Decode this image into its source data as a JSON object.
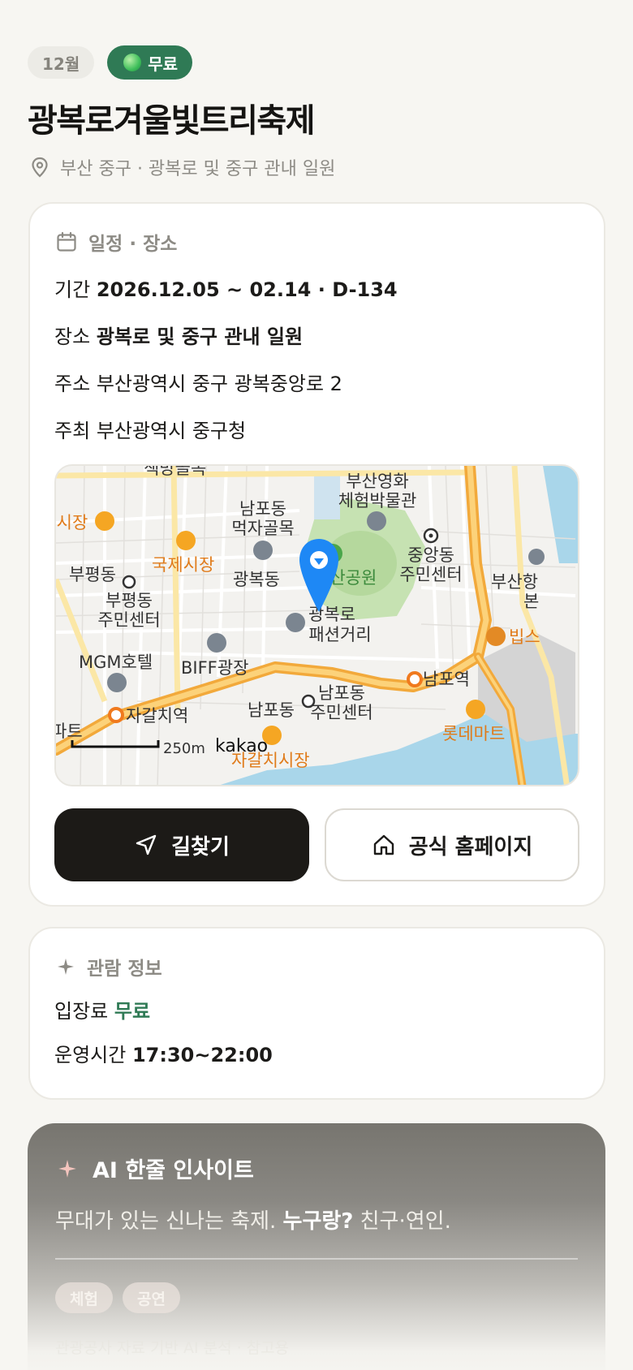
{
  "header": {
    "month_chip": "12월",
    "free_chip": "무료",
    "title": "광복로겨울빛트리축제",
    "location_line": "부산 중구 · 광복로 및 중구 관내 일원"
  },
  "schedule": {
    "section_title": "일정 · 장소",
    "period_label": "기간",
    "period_value": "2026.12.05 ~ 02.14 · D-134",
    "place_label": "장소",
    "place_value": "광복로 및 중구 관내 일원",
    "address_label": "주소",
    "address_value": "부산광역시 중구 광복중앙로 2",
    "host_label": "주최",
    "host_value": "부산광역시 중구청"
  },
  "map": {
    "labels": {
      "busan_cinema_1": "부산영화",
      "busan_cinema_2": "체험박물관",
      "nampo_food_1": "남포동",
      "nampo_food_2": "먹자골목",
      "market_left": "·시장",
      "gukje_market": "국제시장",
      "bupyeong": "부평동",
      "bupyeong_center_1": "부평동",
      "bupyeong_center_2": "주민센터",
      "gwangbok": "광복동",
      "yongdusan": "부산공원",
      "jungang_1": "중앙동",
      "jungang_2": "주민센터",
      "busan_port_1": "부산항",
      "busan_port_2": "본",
      "fashion_1": "광복로",
      "fashion_2": "패션거리",
      "vips": "빕스",
      "mgm": "MGM호텔",
      "biff": "BIFF광장",
      "nampo_station": "남포역",
      "jagalchi_station": "자갈치역",
      "nampo_center_1": "남포동",
      "nampo_center_2": "주민센터",
      "nampo_dong": "남포동",
      "apart": "파트",
      "lotte": "롯데마트",
      "jagalchi_market": "자갈치시장",
      "top_cut": "책방골목",
      "scale": "250m",
      "brand": "kakao"
    }
  },
  "actions": {
    "route_label": "길찾기",
    "homepage_label": "공식 홈페이지"
  },
  "visit": {
    "section_title": "관람 정보",
    "fee_label": "입장료",
    "fee_value": "무료",
    "hours_label": "운영시간",
    "hours_value": "17:30~22:00"
  },
  "ai": {
    "title": "AI 한줄 인사이트",
    "text_prefix": "무대가 있는 신나는 축제.",
    "who_label": "누구랑?",
    "who_value": "친구·연인.",
    "tags": [
      "체험",
      "공연"
    ],
    "note": "관광공사 자료 기반 AI 분석 · 참고용"
  },
  "colors": {
    "accent_green": "#2f7a55",
    "dark_button": "#1c1a17",
    "map_pin": "#1e88f5",
    "map_road": "#f5a623"
  }
}
